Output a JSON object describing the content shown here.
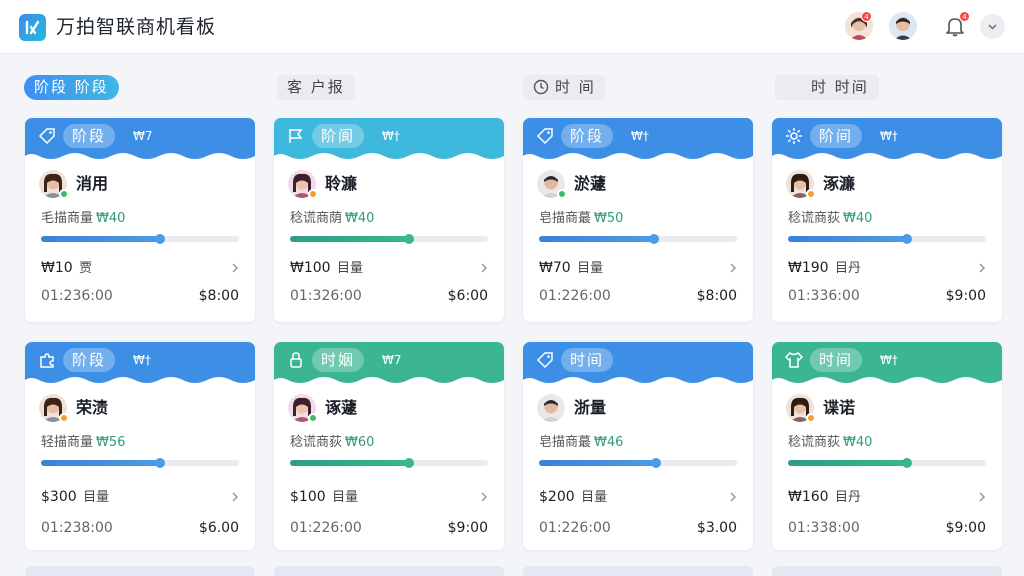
{
  "header": {
    "title": "万拍智联商机看板",
    "user_badge": "4",
    "bell_badge": "4",
    "colors": {
      "logo": "#3b8cf0",
      "badge": "#f04848"
    }
  },
  "filters": [
    {
      "label": "阶段 阶段",
      "active": true
    },
    {
      "label": "客 户报",
      "active": false
    },
    {
      "label": "时 间",
      "active": false,
      "icon": "clock-icon"
    },
    {
      "label": "时 时间",
      "active": false
    }
  ],
  "cards": [
    {
      "stage": "阶段",
      "tag": "₩7",
      "head_icon": "tag-icon",
      "name": "消用",
      "prob_label": "毛描商量",
      "prob_value": "₩40",
      "progress": 0.6,
      "amount": "₩10",
      "amount_unit": "贾",
      "time_left": "01:236:00",
      "time_right": "$8:00",
      "status": "#3dbb6a",
      "theme": "blue"
    },
    {
      "stage": "阶阆",
      "tag": "₩†",
      "head_icon": "flag-icon",
      "name": "聆濂",
      "prob_label": "稔谎商荫",
      "prob_value": "₩40",
      "progress": 0.6,
      "amount": "₩100",
      "amount_unit": "目量",
      "time_left": "01:326:00",
      "time_right": "$6:00",
      "status": "#f0a030",
      "theme": "cyan"
    },
    {
      "stage": "阶段",
      "tag": "₩†",
      "head_icon": "tag-icon",
      "name": "淤蘧",
      "prob_label": "皂描商蕞",
      "prob_value": "₩50",
      "progress": 0.58,
      "amount": "₩70",
      "amount_unit": "目量",
      "time_left": "01:226:00",
      "time_right": "$8:00",
      "status": "#3dbb6a",
      "theme": "blue"
    },
    {
      "stage": "阶间",
      "tag": "₩†",
      "head_icon": "gear-icon",
      "name": "涿濂",
      "prob_label": "稔谎商荻",
      "prob_value": "₩40",
      "progress": 0.6,
      "amount": "₩190",
      "amount_unit": "目丹",
      "time_left": "01:336:00",
      "time_right": "$9:00",
      "status": "#f0a030",
      "theme": "blue"
    },
    {
      "stage": "阶段",
      "tag": "₩†",
      "head_icon": "puzzle-icon",
      "name": "荣渍",
      "prob_label": "轻描商量",
      "prob_value": "₩56",
      "progress": 0.6,
      "amount": "$300",
      "amount_unit": "目量",
      "time_left": "01:238:00",
      "time_right": "$6.00",
      "status": "#f0a030",
      "theme": "blue"
    },
    {
      "stage": "时姻",
      "tag": "₩7",
      "head_icon": "lock-icon",
      "name": "诼蘧",
      "prob_label": "稔谎商荻",
      "prob_value": "₩60",
      "progress": 0.6,
      "amount": "$100",
      "amount_unit": "目量",
      "time_left": "01:226:00",
      "time_right": "$9:00",
      "status": "#3dbb6a",
      "theme": "green"
    },
    {
      "stage": "时间",
      "tag": "",
      "head_icon": "tag-icon",
      "name": "浙量",
      "prob_label": "皂描商蕞",
      "prob_value": "₩46",
      "progress": 0.59,
      "amount": "$200",
      "amount_unit": "目量",
      "time_left": "01:226:00",
      "time_right": "$3.00",
      "status": "",
      "theme": "blue"
    },
    {
      "stage": "时间",
      "tag": "₩†",
      "head_icon": "shirt-icon",
      "name": "谍诺",
      "prob_label": "稔谎商荻",
      "prob_value": "₩40",
      "progress": 0.6,
      "amount": "₩160",
      "amount_unit": "目丹",
      "time_left": "01:338:00",
      "time_right": "$9:00",
      "status": "#f0a030",
      "theme": "green"
    }
  ],
  "themes": {
    "blue": {
      "head": "#3d8fe6",
      "fill": "#3b82d8"
    },
    "cyan": {
      "head": "#3fb8dd",
      "fill": "#2e9b88"
    },
    "green": {
      "head": "#3bb691",
      "fill": "#2e9b88"
    }
  }
}
